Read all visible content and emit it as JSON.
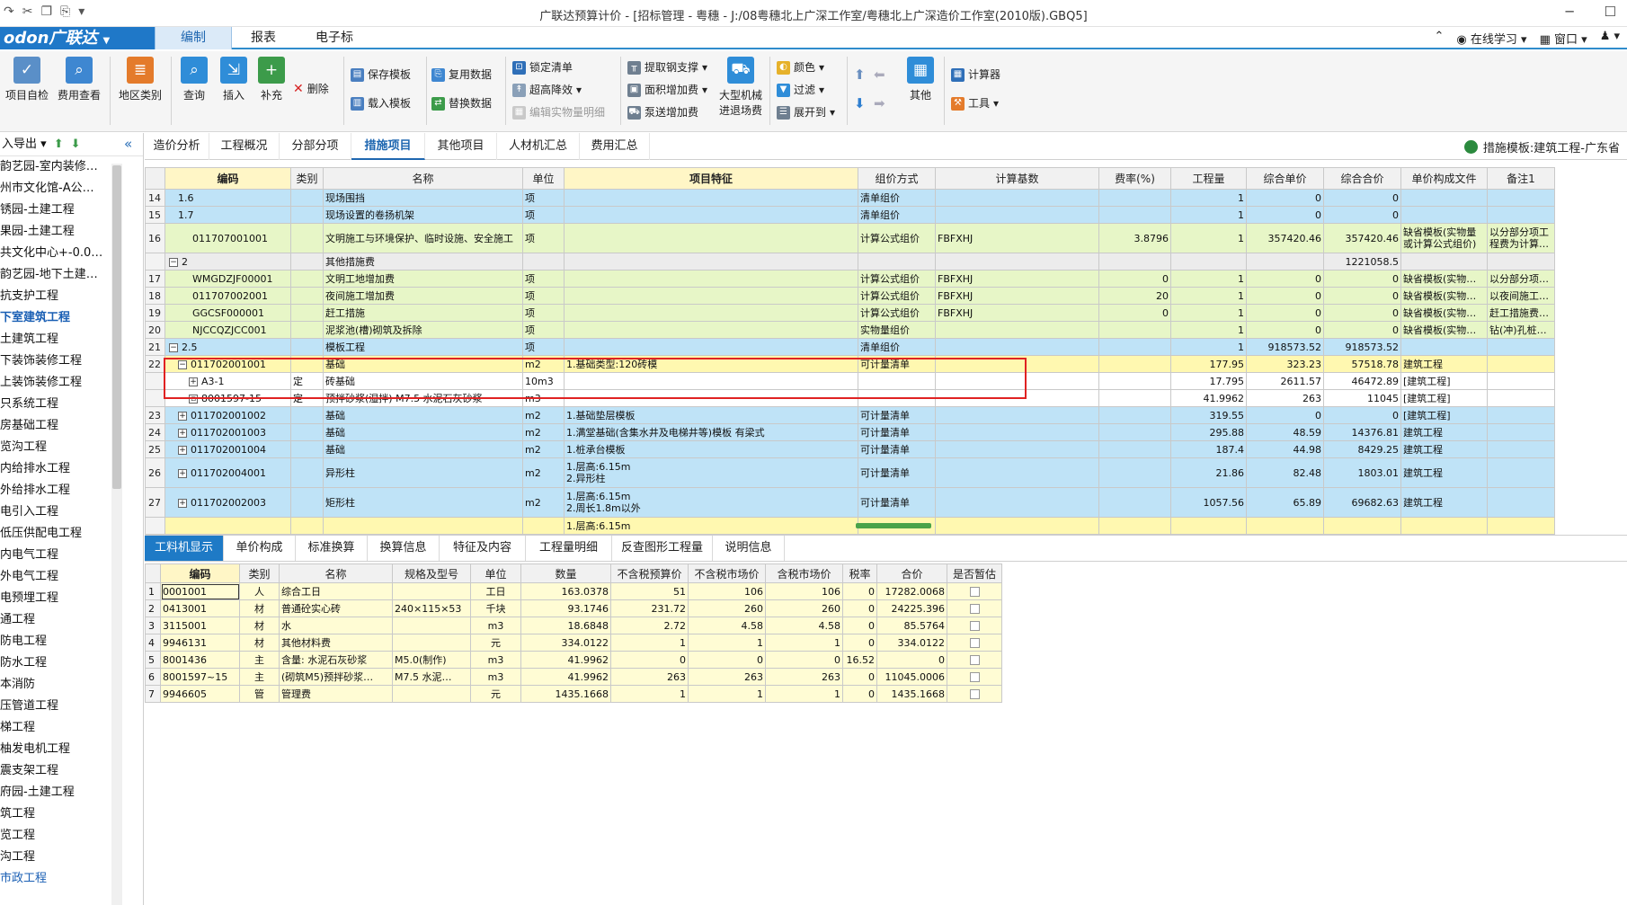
{
  "window": {
    "title": "广联达预算计价 - [招标管理 - 粤穗 - J:/08粤穗北上广深工作室/粤穗北上广深造价工作室(2010版).GBQ5]"
  },
  "menubar": {
    "logo": "odon广联达",
    "tabs": [
      "编制",
      "报表",
      "电子标"
    ],
    "right": {
      "learn": "在线学习",
      "window": "窗口"
    }
  },
  "ribbon": {
    "big": [
      "项目自检",
      "费用查看",
      "地区类别",
      "查询",
      "插入",
      "补充",
      "大型机械进退场费",
      "其他"
    ],
    "small": {
      "delete": "删除",
      "save_tpl": "保存模板",
      "load_tpl": "载入模板",
      "reuse": "复用数据",
      "replace": "替换数据",
      "lock": "锁定清单",
      "overheight": "超高降效",
      "measures": "编辑实物量明细",
      "steel": "提取钢支撑",
      "area": "面积增加费",
      "pump": "泵送增加费",
      "color": "颜色",
      "filter": "过滤",
      "expand": "展开到",
      "calc": "计算器",
      "tools": "工具"
    }
  },
  "leftpanel": {
    "header": "入导出",
    "items": [
      "韵艺园-室内装修…",
      "州市文化馆-A公…",
      "锈园-土建工程",
      "果园-土建工程",
      "共文化中心+-0.0…",
      "韵艺园-地下土建…",
      "抗支护工程",
      "下室建筑工程",
      "土建筑工程",
      "下装饰装修工程",
      "上装饰装修工程",
      "只系统工程",
      "房基础工程",
      "览沟工程",
      "内给排水工程",
      "外给排水工程",
      "电引入工程",
      "低压供配电工程",
      "内电气工程",
      "外电气工程",
      "电预埋工程",
      "通工程",
      "防电工程",
      "防水工程",
      "本消防",
      "压管道工程",
      "梯工程",
      "柚发电机工程",
      "震支架工程",
      "府园-土建工程",
      "筑工程",
      "览工程",
      "沟工程",
      "市政工程"
    ]
  },
  "tabs1": {
    "items": [
      "造价分析",
      "工程概况",
      "分部分项",
      "措施项目",
      "其他项目",
      "人材机汇总",
      "费用汇总"
    ],
    "template": "措施模板:建筑工程-广东省"
  },
  "grid": {
    "headers": [
      "",
      "编码",
      "类别",
      "名称",
      "单位",
      "项目特征",
      "组价方式",
      "计算基数",
      "费率(%)",
      "工程量",
      "综合单价",
      "综合合价",
      "单价构成文件",
      "备注1"
    ],
    "rows": [
      [
        "14",
        "1.6",
        "",
        "现场围挡",
        "项",
        "",
        "清单组价",
        "",
        "",
        "1",
        "0",
        "0",
        "",
        ""
      ],
      [
        "15",
        "1.7",
        "",
        "现场设置的卷扬机架",
        "项",
        "",
        "清单组价",
        "",
        "",
        "1",
        "0",
        "0",
        "",
        ""
      ],
      [
        "16",
        "011707001001",
        "",
        "文明施工与环境保护、临时设施、安全施工",
        "项",
        "",
        "计算公式组价",
        "FBFXHJ",
        "3.8796",
        "1",
        "357420.46",
        "357420.46",
        "缺省模板(实物量或计算公式组价)",
        "以分部分项工程费为计算…"
      ],
      [
        "",
        "2",
        "",
        "其他措施费",
        "",
        "",
        "",
        "",
        "",
        "",
        "",
        "1221058.5",
        "",
        ""
      ],
      [
        "17",
        "WMGDZJF00001",
        "",
        "文明工地增加费",
        "项",
        "",
        "计算公式组价",
        "FBFXHJ",
        "0",
        "1",
        "0",
        "0",
        "缺省模板(实物…",
        "以分部分项…"
      ],
      [
        "18",
        "011707002001",
        "",
        "夜间施工增加费",
        "项",
        "",
        "计算公式组价",
        "FBFXHJ",
        "20",
        "1",
        "0",
        "0",
        "缺省模板(实物…",
        "以夜间施工…"
      ],
      [
        "19",
        "GGCSF000001",
        "",
        "赶工措施",
        "项",
        "",
        "计算公式组价",
        "FBFXHJ",
        "0",
        "1",
        "0",
        "0",
        "缺省模板(实物…",
        "赶工措施费…"
      ],
      [
        "20",
        "NJCCQZJCC001",
        "",
        "泥浆池(槽)砌筑及拆除",
        "项",
        "",
        "实物量组价",
        "",
        "",
        "1",
        "0",
        "0",
        "缺省模板(实物…",
        "钻(冲)孔桩…"
      ],
      [
        "21",
        "2.5",
        "",
        "模板工程",
        "项",
        "",
        "清单组价",
        "",
        "",
        "1",
        "918573.52",
        "918573.52",
        "",
        ""
      ],
      [
        "22",
        "011702001001",
        "",
        "基础",
        "m2",
        "1.基础类型:120砖模",
        "可计量清单",
        "",
        "",
        "177.95",
        "323.23",
        "57518.78",
        "建筑工程",
        ""
      ],
      [
        "",
        "A3-1",
        "定",
        "砖基础",
        "10m3",
        "",
        "",
        "",
        "",
        "17.795",
        "2611.57",
        "46472.89",
        "[建筑工程]",
        ""
      ],
      [
        "",
        "8001597-15",
        "定",
        "预拌砂浆(湿拌) M7.5 水泥石灰砂浆",
        "m3",
        "",
        "",
        "",
        "",
        "41.9962",
        "263",
        "11045",
        "[建筑工程]",
        ""
      ],
      [
        "23",
        "011702001002",
        "",
        "基础",
        "m2",
        "1.基础垫层模板",
        "可计量清单",
        "",
        "",
        "319.55",
        "0",
        "0",
        "[建筑工程]",
        ""
      ],
      [
        "24",
        "011702001003",
        "",
        "基础",
        "m2",
        "1.满堂基础(含集水井及电梯井等)模板 有梁式",
        "可计量清单",
        "",
        "",
        "295.88",
        "48.59",
        "14376.81",
        "建筑工程",
        ""
      ],
      [
        "25",
        "011702001004",
        "",
        "基础",
        "m2",
        "1.桩承台模板",
        "可计量清单",
        "",
        "",
        "187.4",
        "44.98",
        "8429.25",
        "建筑工程",
        ""
      ],
      [
        "26",
        "011702004001",
        "",
        "异形柱",
        "m2",
        "1.层高:6.15m|2.异形柱",
        "可计量清单",
        "",
        "",
        "21.86",
        "82.48",
        "1803.01",
        "建筑工程",
        ""
      ],
      [
        "27",
        "011702002003",
        "",
        "矩形柱",
        "m2",
        "1.层高:6.15m|2.周长1.8m以外",
        "可计量清单",
        "",
        "",
        "1057.56",
        "65.89",
        "69682.63",
        "建筑工程",
        ""
      ],
      [
        "",
        "",
        "",
        "",
        "",
        "1.层高:6.15m",
        "",
        "",
        "",
        "",
        "",
        "",
        "",
        ""
      ]
    ]
  },
  "tabs2": {
    "items": [
      "工料机显示",
      "单价构成",
      "标准换算",
      "换算信息",
      "特征及内容",
      "工程量明细",
      "反查图形工程量",
      "说明信息"
    ]
  },
  "grid2": {
    "headers": [
      "",
      "编码",
      "类别",
      "名称",
      "规格及型号",
      "单位",
      "数量",
      "不含税预算价",
      "不含税市场价",
      "含税市场价",
      "税率",
      "合价",
      "是否暂估"
    ],
    "rows": [
      [
        "1",
        "0001001",
        "人",
        "综合工日",
        "",
        "工日",
        "163.0378",
        "51",
        "106",
        "106",
        "0",
        "17282.0068",
        ""
      ],
      [
        "2",
        "0413001",
        "材",
        "普通砼实心砖",
        "240×115×53",
        "千块",
        "93.1746",
        "231.72",
        "260",
        "260",
        "0",
        "24225.396",
        ""
      ],
      [
        "3",
        "3115001",
        "材",
        "水",
        "",
        "m3",
        "18.6848",
        "2.72",
        "4.58",
        "4.58",
        "0",
        "85.5764",
        ""
      ],
      [
        "4",
        "9946131",
        "材",
        "其他材料费",
        "",
        "元",
        "334.0122",
        "1",
        "1",
        "1",
        "0",
        "334.0122",
        ""
      ],
      [
        "5",
        "8001436",
        "主",
        "含量: 水泥石灰砂浆",
        "M5.0(制作)",
        "m3",
        "41.9962",
        "0",
        "0",
        "0",
        "16.52",
        "0",
        ""
      ],
      [
        "6",
        "8001597~15",
        "主",
        "(砌筑M5)预拌砂浆…",
        "M7.5 水泥…",
        "m3",
        "41.9962",
        "263",
        "263",
        "263",
        "0",
        "11045.0006",
        ""
      ],
      [
        "7",
        "9946605",
        "管",
        "管理费",
        "",
        "元",
        "1435.1668",
        "1",
        "1",
        "1",
        "0",
        "1435.1668",
        ""
      ]
    ]
  },
  "colors": {
    "accent": "#1e7ac6",
    "row_blue": "#bfe3f7",
    "row_green": "#e7f6c7",
    "row_yellow": "#fff8b0",
    "highlight": "#e02222"
  }
}
